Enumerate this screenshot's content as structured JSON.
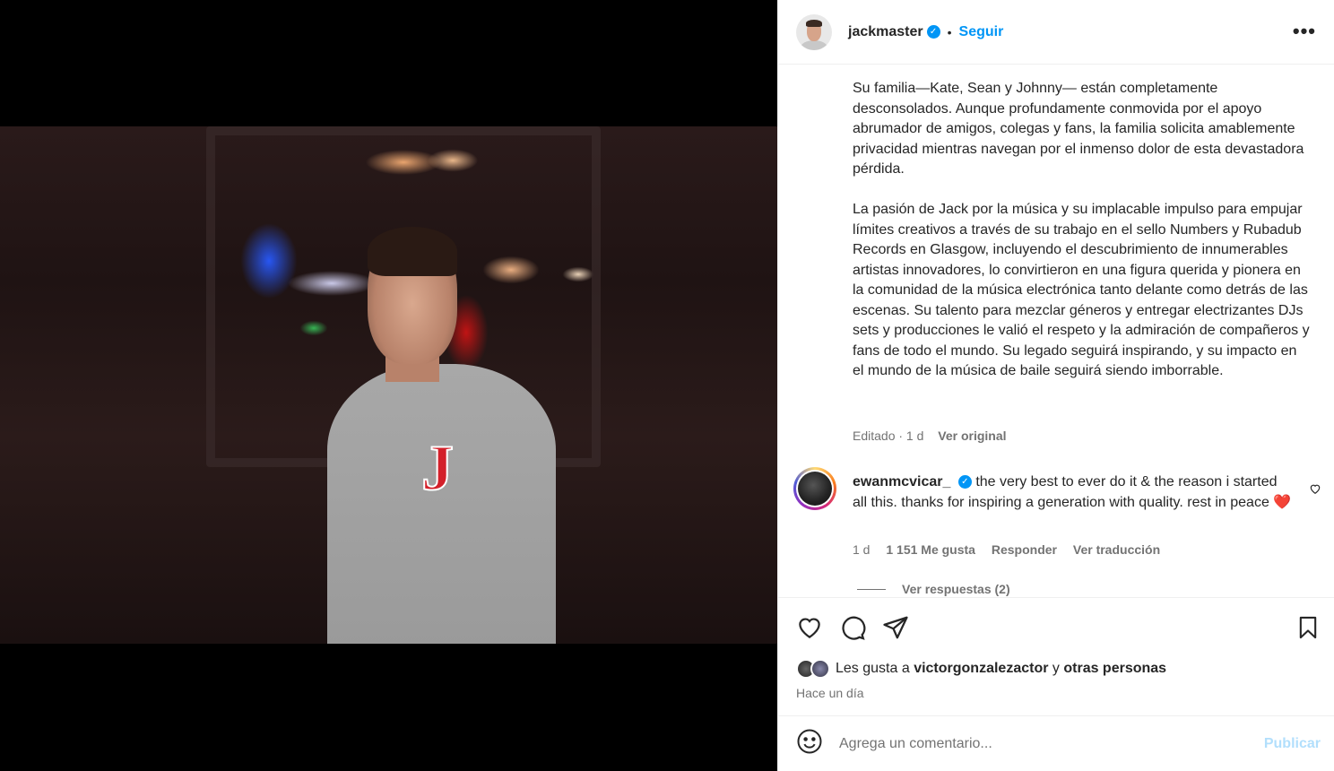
{
  "post": {
    "username": "jackmaster",
    "separator": "•",
    "follow_label": "Seguir",
    "more_label": "•••",
    "caption": "Su familia—Kate, Sean y Johnny— están completamente desconsolados. Aunque profundamente conmovida por el apoyo abrumador de amigos, colegas y fans, la familia solicita amablemente privacidad mientras navegan por el inmenso dolor de esta devastadora pérdida.\n\nLa pasión de Jack por la música y su implacable impulso para empujar límites creativos a través de su trabajo en el sello Numbers y Rubadub Records en Glasgow, incluyendo el descubrimiento de innumerables artistas innovadores, lo convirtieron en una figura querida y pionera en la comunidad de la música electrónica tanto delante como detrás de las escenas. Su talento para mezclar géneros y entregar electrizantes DJs sets y producciones le valió el respeto y la admiración de compañeros y fans de todo el mundo. Su legado seguirá inspirando, y su impacto en el mundo de la música de baile seguirá siendo imborrable.",
    "edited_label": "Editado · 1 d",
    "see_original": "Ver original",
    "photo_letter": "J"
  },
  "comment": {
    "username": "ewanmcvicar_",
    "text": "the very best to ever do it & the reason i started all this. thanks for inspiring a generation with quality. rest in peace",
    "emoji": "❤️",
    "time": "1 d",
    "likes": "1 151 Me gusta",
    "reply": "Responder",
    "translate": "Ver traducción",
    "view_replies": "Ver respuestas (2)"
  },
  "actions": {
    "liked_by_prefix": "Les gusta a",
    "liked_by_user": "victorgonzalezactor",
    "liked_by_join": "y",
    "liked_by_others": "otras personas",
    "time_ago": "Hace un día"
  },
  "composer": {
    "placeholder": "Agrega un comentario...",
    "publish": "Publicar"
  },
  "colors": {
    "accent": "#0095f6",
    "publish_disabled": "#b2dffc",
    "heart": "#ed1c24"
  }
}
